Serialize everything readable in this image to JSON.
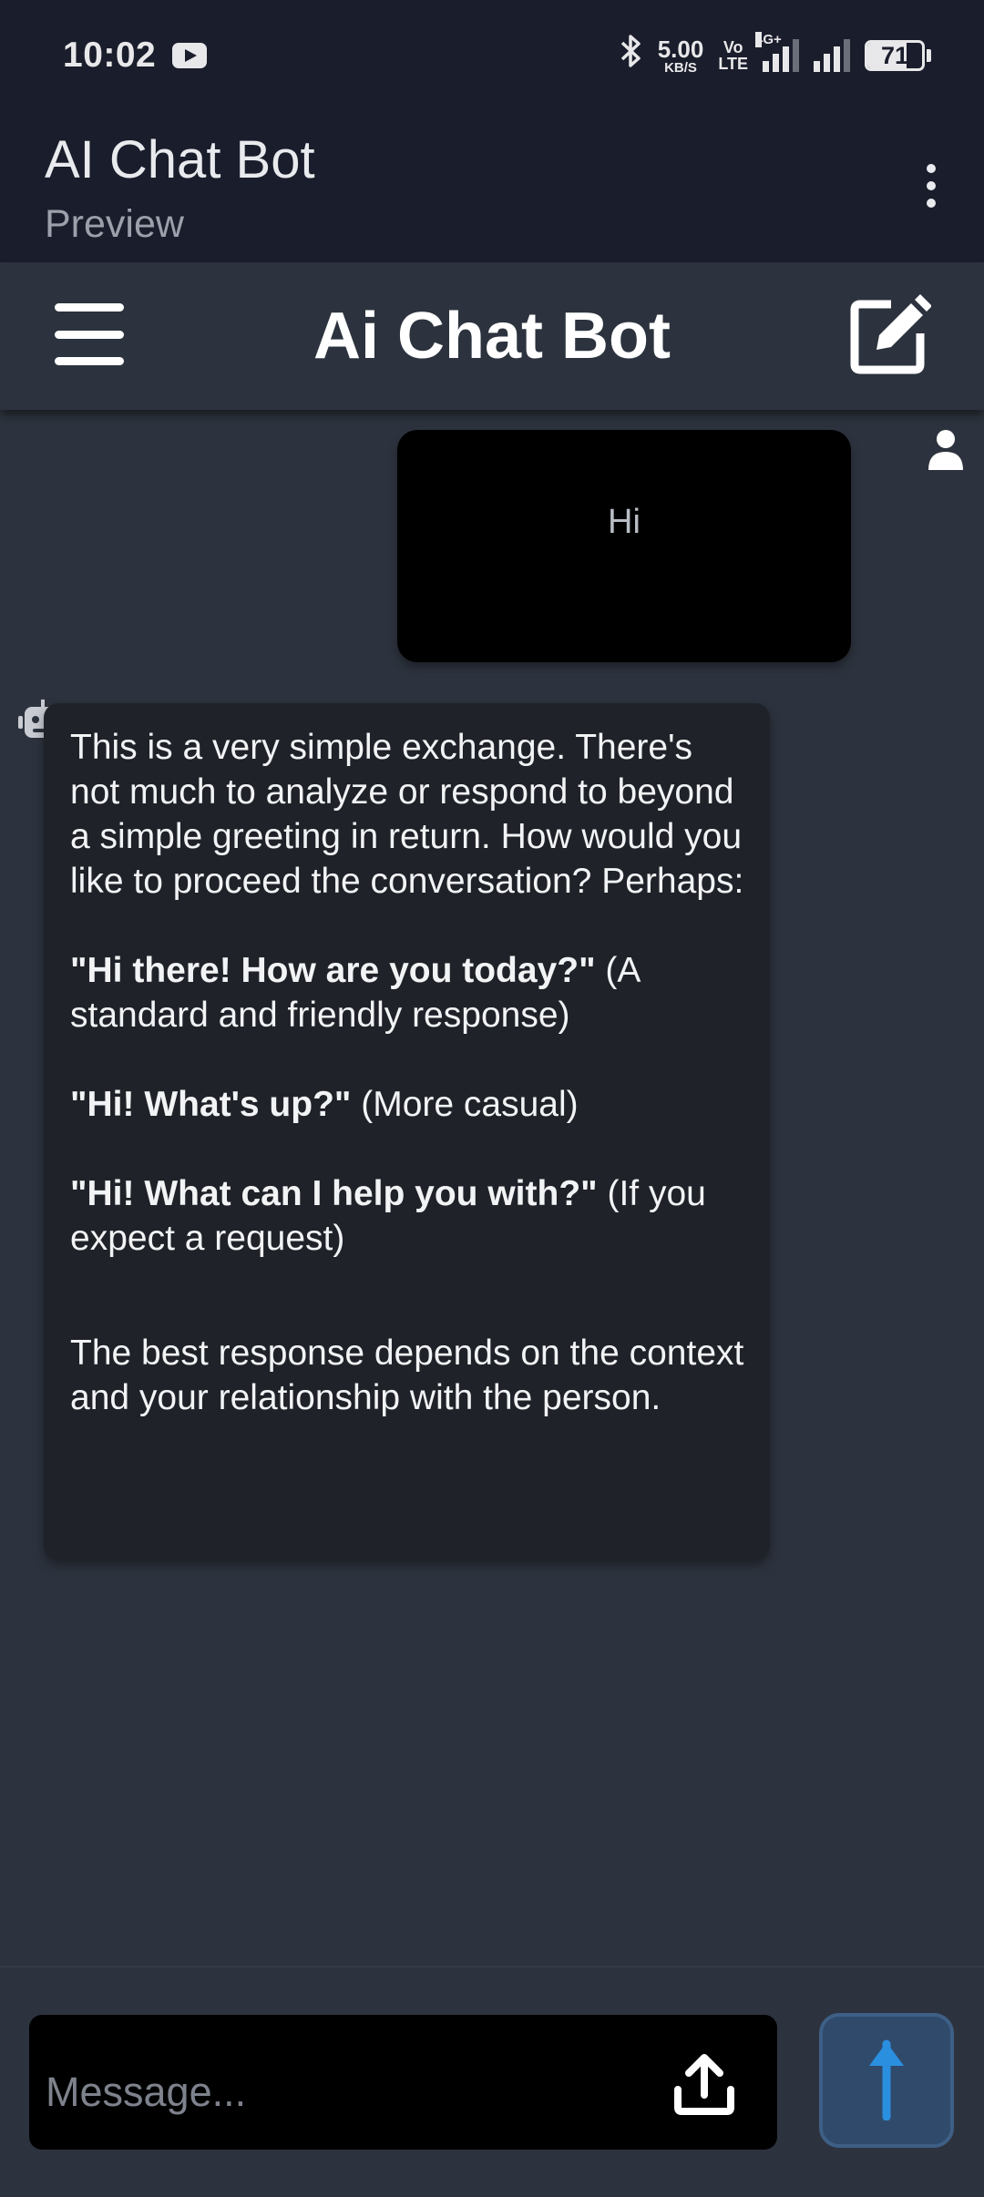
{
  "status_bar": {
    "time": "10:02",
    "speed_value": "5.00",
    "speed_unit": "KB/S",
    "volte_top": "Vo",
    "volte_bottom": "LTE",
    "network": "4G+",
    "battery": "71",
    "battery_level": 0.71
  },
  "preview_header": {
    "title": "AI Chat Bot",
    "subtitle": "Preview"
  },
  "app_bar": {
    "title": "Ai Chat Bot"
  },
  "chat": {
    "user_message": "Hi",
    "bot_message": {
      "intro": "This is a very simple exchange.  There's not much to analyze or respond to beyond a simple greeting in return.  How would you like to proceed the conversation?  Perhaps:",
      "options": [
        {
          "quote": "\"Hi there! How are you today?\"",
          "note": " (A standard and friendly response)"
        },
        {
          "quote": "\"Hi! What's up?\"",
          "note": " (More casual)"
        },
        {
          "quote": "\"Hi!  What can I help you with?\"",
          "note": " (If you expect a request)"
        }
      ],
      "conclusion": "The best response depends on the context and your relationship with the person."
    }
  },
  "composer": {
    "placeholder": "Message..."
  },
  "icons": {
    "menu": "menu-icon",
    "edit": "edit-icon",
    "user": "user-icon",
    "bot": "robot-icon",
    "upload": "upload-icon",
    "send": "arrow-up-icon"
  },
  "colors": {
    "background": "#2d333e",
    "header": "#1a1d2b",
    "send_accent": "#2b8fe0"
  }
}
